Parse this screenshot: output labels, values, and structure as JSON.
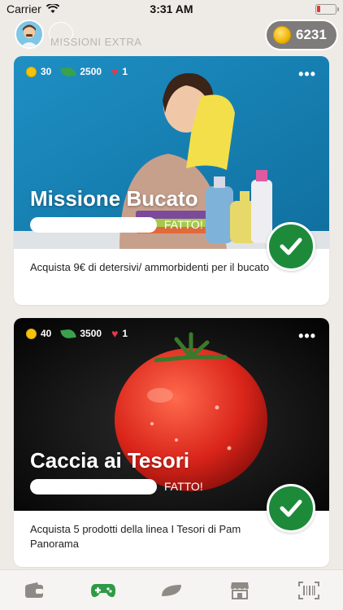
{
  "status_bar": {
    "carrier": "Carrier",
    "time": "3:31 AM"
  },
  "header": {
    "title": "MISSIONI EXTRA",
    "coins": "6231"
  },
  "colors": {
    "accent_green": "#1d8a3a",
    "tab_active": "#2e9a47",
    "tab_inactive": "#8e8a86"
  },
  "missions": [
    {
      "coins": "30",
      "points": "2500",
      "lives": "1",
      "title": "Missione Bucato",
      "status": "FATTO!",
      "progress": 0,
      "description": "Acquista 9€ di detersivi/ ammorbidenti per il bucato"
    },
    {
      "coins": "40",
      "points": "3500",
      "lives": "1",
      "title": "Caccia ai Tesori",
      "status": "FATTO!",
      "progress": 0,
      "description": "Acquista 5 prodotti della linea I Tesori di Pam Panorama"
    }
  ],
  "tabs": [
    {
      "icon": "wallet-icon",
      "active": false
    },
    {
      "icon": "gamepad-icon",
      "active": true
    },
    {
      "icon": "leaf-icon",
      "active": false
    },
    {
      "icon": "store-icon",
      "active": false
    },
    {
      "icon": "barcode-icon",
      "active": false
    }
  ]
}
